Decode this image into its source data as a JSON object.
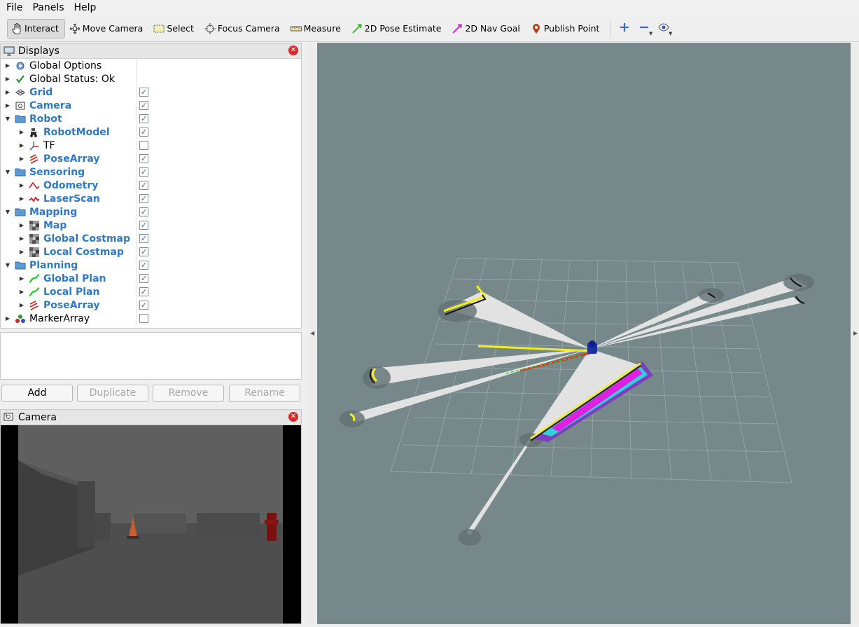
{
  "menu": {
    "items": [
      "File",
      "Panels",
      "Help"
    ]
  },
  "toolbar": {
    "tools": [
      {
        "label": "Interact",
        "icon": "hand-cursor-icon",
        "active": true
      },
      {
        "label": "Move Camera",
        "icon": "move-camera-icon"
      },
      {
        "label": "Select",
        "icon": "select-box-icon"
      },
      {
        "label": "Focus Camera",
        "icon": "focus-camera-icon"
      },
      {
        "label": "Measure",
        "icon": "ruler-icon"
      },
      {
        "label": "2D Pose Estimate",
        "icon": "green-arrow-icon"
      },
      {
        "label": "2D Nav Goal",
        "icon": "magenta-arrow-icon"
      },
      {
        "label": "Publish Point",
        "icon": "map-pin-icon"
      }
    ]
  },
  "displays": {
    "title": "Displays",
    "items": [
      {
        "label": "Global Options",
        "icon": "gear-icon",
        "level": 0,
        "expanded": false,
        "blue": false,
        "checkbox": null
      },
      {
        "label": "Global Status: Ok",
        "icon": "check-icon",
        "level": 0,
        "expanded": false,
        "blue": false,
        "checkbox": null
      },
      {
        "label": "Grid",
        "icon": "grid-icon",
        "level": 0,
        "expanded": false,
        "blue": true,
        "checkbox": true
      },
      {
        "label": "Camera",
        "icon": "camera-icon",
        "level": 0,
        "expanded": false,
        "blue": true,
        "checkbox": true
      },
      {
        "label": "Robot",
        "icon": "folder-icon",
        "level": 0,
        "expanded": true,
        "blue": true,
        "checkbox": true
      },
      {
        "label": "RobotModel",
        "icon": "robot-model-icon",
        "level": 1,
        "expanded": false,
        "blue": true,
        "checkbox": true
      },
      {
        "label": "TF",
        "icon": "tf-axes-icon",
        "level": 1,
        "expanded": false,
        "blue": false,
        "checkbox": false
      },
      {
        "label": "PoseArray",
        "icon": "pose-array-icon",
        "level": 1,
        "expanded": false,
        "blue": true,
        "checkbox": true
      },
      {
        "label": "Sensoring",
        "icon": "folder-icon",
        "level": 0,
        "expanded": true,
        "blue": true,
        "checkbox": true
      },
      {
        "label": "Odometry",
        "icon": "odometry-icon",
        "level": 1,
        "expanded": false,
        "blue": true,
        "checkbox": true
      },
      {
        "label": "LaserScan",
        "icon": "laserscan-icon",
        "level": 1,
        "expanded": false,
        "blue": true,
        "checkbox": true
      },
      {
        "label": "Mapping",
        "icon": "folder-icon",
        "level": 0,
        "expanded": true,
        "blue": true,
        "checkbox": true
      },
      {
        "label": "Map",
        "icon": "map-grid-icon",
        "level": 1,
        "expanded": false,
        "blue": true,
        "checkbox": true
      },
      {
        "label": "Global Costmap",
        "icon": "map-grid-icon",
        "level": 1,
        "expanded": false,
        "blue": true,
        "checkbox": true
      },
      {
        "label": "Local Costmap",
        "icon": "map-grid-icon",
        "level": 1,
        "expanded": false,
        "blue": true,
        "checkbox": true
      },
      {
        "label": "Planning",
        "icon": "folder-icon",
        "level": 0,
        "expanded": true,
        "blue": true,
        "checkbox": true
      },
      {
        "label": "Global Plan",
        "icon": "path-icon",
        "level": 1,
        "expanded": false,
        "blue": true,
        "checkbox": true
      },
      {
        "label": "Local Plan",
        "icon": "path-icon",
        "level": 1,
        "expanded": false,
        "blue": true,
        "checkbox": true
      },
      {
        "label": "PoseArray",
        "icon": "pose-array-icon",
        "level": 1,
        "expanded": false,
        "blue": true,
        "checkbox": true
      },
      {
        "label": "MarkerArray",
        "icon": "marker-array-icon",
        "level": 0,
        "expanded": false,
        "blue": false,
        "checkbox": false
      }
    ]
  },
  "buttons": {
    "add": "Add",
    "duplicate": "Duplicate",
    "remove": "Remove",
    "rename": "Rename"
  },
  "camera_panel": {
    "title": "Camera"
  },
  "colors": {
    "blue_label": "#2f79c8",
    "viewport_bg": "#76888a",
    "close_red": "#d92b2b"
  }
}
